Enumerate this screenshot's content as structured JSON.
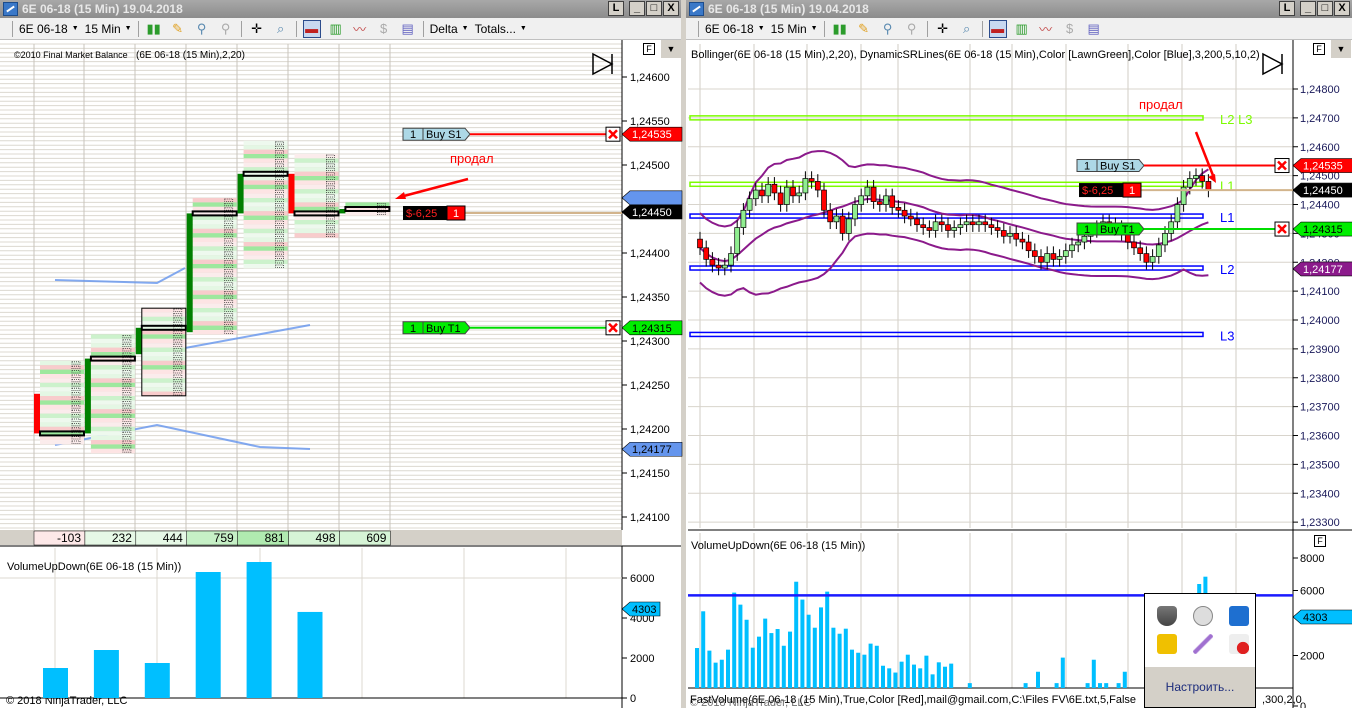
{
  "left": {
    "title": "6E 06-18 (15 Min)  19.04.2018",
    "instrument": "6E 06-18",
    "interval": "15 Min",
    "menu_delta": "Delta",
    "menu_totals": "Totals...",
    "watermark": "©2010 Final Market Balance",
    "indicator_label": "(6E 06-18 (15 Min),2,20)",
    "price_ticks": [
      "1,24600",
      "1,24550",
      "1,24500",
      "1,24400",
      "1,24350",
      "1,24300",
      "1,24250",
      "1,24200",
      "1,24150",
      "1,24100"
    ],
    "price_tick_values": [
      1.246,
      1.2455,
      1.245,
      1.244,
      1.2435,
      1.243,
      1.2425,
      1.242,
      1.2415,
      1.241
    ],
    "tags": {
      "stop": "1,24535",
      "last": "1,24450",
      "target": "1,24315",
      "lower": "1,24177"
    },
    "orders": {
      "stop_qty": "1",
      "stop_label": "Buy S1",
      "target_qty": "1",
      "target_label": "Buy T1",
      "pnl": "$-6,25",
      "pos_qty": "1"
    },
    "annotation": "продал",
    "footprint_bars": [
      {
        "o": 1.2424,
        "c": 1.24195,
        "h": 1.24275,
        "l": 1.24185
      },
      {
        "o": 1.24195,
        "c": 1.2428,
        "h": 1.24305,
        "l": 1.24175
      },
      {
        "o": 1.24285,
        "c": 1.24315,
        "h": 1.24335,
        "l": 1.2424
      },
      {
        "o": 1.2431,
        "c": 1.24445,
        "h": 1.2446,
        "l": 1.2431
      },
      {
        "o": 1.24445,
        "c": 1.2449,
        "h": 1.24525,
        "l": 1.24385
      },
      {
        "o": 1.2449,
        "c": 1.24445,
        "h": 1.2451,
        "l": 1.2442
      },
      {
        "o": 1.24445,
        "c": 1.2445,
        "h": 1.24455,
        "l": 1.24445
      }
    ],
    "totals": [
      "-103",
      "232",
      "444",
      "759",
      "881",
      "498",
      "609"
    ],
    "volume": {
      "label": "VolumeUpDown(6E 06-18 (15 Min))",
      "ticks": [
        "6000",
        "4000",
        "2000",
        "0"
      ],
      "tick_values": [
        6000,
        4000,
        2000,
        0
      ],
      "last": "4303",
      "values": [
        1500,
        2400,
        1750,
        6300,
        6800,
        4303
      ]
    },
    "copyright": "© 2018 NinjaTrader, LLC"
  },
  "right": {
    "title": "6E 06-18 (15 Min)  19.04.2018",
    "instrument": "6E 06-18",
    "interval": "15 Min",
    "indicator_label": "Bollinger(6E 06-18 (15 Min),2,20), DynamicSRLines(6E 06-18 (15 Min),Color [LawnGreen],Color [Blue],3,200,5,10,2)",
    "price_ticks": [
      "1,24800",
      "1,24700",
      "1,24600",
      "1,24500",
      "1,24400",
      "1,24300",
      "1,24200",
      "1,24100",
      "1,24000",
      "1,23900",
      "1,23800",
      "1,23700",
      "1,23600",
      "1,23500",
      "1,23400",
      "1,23300"
    ],
    "price_tick_values": [
      1.248,
      1.247,
      1.246,
      1.245,
      1.244,
      1.243,
      1.242,
      1.241,
      1.24,
      1.239,
      1.238,
      1.237,
      1.236,
      1.235,
      1.234,
      1.233
    ],
    "tags": {
      "stop": "1,24535",
      "last": "1,24450",
      "target": "1,24315",
      "lower": "1,24177"
    },
    "orders": {
      "stop_qty": "1",
      "stop_label": "Buy S1",
      "target_qty": "1",
      "target_label": "Buy T1",
      "pnl": "$-6,25",
      "pos_qty": "1"
    },
    "annotation": "продал",
    "sr_lines": [
      {
        "label": "L2 L3",
        "price": 1.247,
        "color": "#7cfc00"
      },
      {
        "label": "L1",
        "price": 1.2447,
        "color": "#7cfc00"
      },
      {
        "label": "L1",
        "price": 1.2436,
        "color": "#0000ff"
      },
      {
        "label": "L2",
        "price": 1.2418,
        "color": "#0000ff"
      },
      {
        "label": "L3",
        "price": 1.2395,
        "color": "#0000ff"
      }
    ],
    "closes": [
      1.2425,
      1.2421,
      1.2419,
      1.2418,
      1.2419,
      1.2423,
      1.2432,
      1.2438,
      1.2442,
      1.2445,
      1.2443,
      1.2447,
      1.2444,
      1.244,
      1.2446,
      1.2443,
      1.2444,
      1.2449,
      1.2448,
      1.2445,
      1.2438,
      1.2434,
      1.2436,
      1.243,
      1.2435,
      1.244,
      1.2443,
      1.2446,
      1.2441,
      1.244,
      1.2443,
      1.2439,
      1.2438,
      1.2436,
      1.2435,
      1.2433,
      1.2432,
      1.2431,
      1.2434,
      1.2433,
      1.2431,
      1.2432,
      1.2433,
      1.2434,
      1.2433,
      1.2434,
      1.2433,
      1.2432,
      1.2431,
      1.2429,
      1.243,
      1.2428,
      1.2427,
      1.2424,
      1.2422,
      1.242,
      1.2423,
      1.2421,
      1.2422,
      1.2424,
      1.2426,
      1.2427,
      1.2429,
      1.2431,
      1.2432,
      1.2434,
      1.2433,
      1.2432,
      1.243,
      1.2427,
      1.2425,
      1.2423,
      1.242,
      1.2422,
      1.2426,
      1.243,
      1.2434,
      1.244,
      1.2446,
      1.2449,
      1.245,
      1.2448,
      1.2445
    ],
    "volume": {
      "label": "VolumeUpDown(6E 06-18 (15 Min))",
      "ticks": [
        "8000",
        "6000",
        "2000",
        "0"
      ],
      "tick_values": [
        8000,
        6000,
        2000,
        0
      ],
      "last": "4303",
      "avg_line": 5700,
      "values": [
        2460,
        4720,
        2300,
        1560,
        1740,
        2360,
        5870,
        5130,
        4200,
        2480,
        3160,
        4270,
        3380,
        3630,
        2600,
        3470,
        6540,
        5440,
        4510,
        3710,
        4960,
        5930,
        3710,
        3340,
        3650,
        2360,
        2170,
        2050,
        2730,
        2600,
        1370,
        1210,
        950,
        1620,
        2050,
        1440,
        1210,
        1990,
        840,
        1580,
        1310,
        1500,
        0,
        0,
        300,
        0,
        0,
        0,
        0,
        0,
        0,
        0,
        0,
        300,
        0,
        1000,
        0,
        0,
        300,
        1870,
        0,
        0,
        0,
        300,
        1740,
        300,
        300,
        0,
        300,
        1000,
        0,
        0,
        0,
        0,
        0,
        0,
        0,
        0,
        0,
        0,
        0,
        6400,
        6850
      ]
    },
    "footer_text": "FastVolume(6E 06-18 (15 Min),True,Color [Red],mail@gmail.com,C:\\Files FV\\6E.txt,5,False",
    "footer_tail": ",300,2,0",
    "copyright": "© 2018 NinjaTrader, LLC"
  },
  "tray_popup": {
    "customize": "Настроить..."
  },
  "colors": {
    "up": "#90ee90",
    "down": "#ff0000",
    "bollinger": "#8b1a8b",
    "tag_blue": "#6495ed",
    "volume": "#00bfff"
  }
}
